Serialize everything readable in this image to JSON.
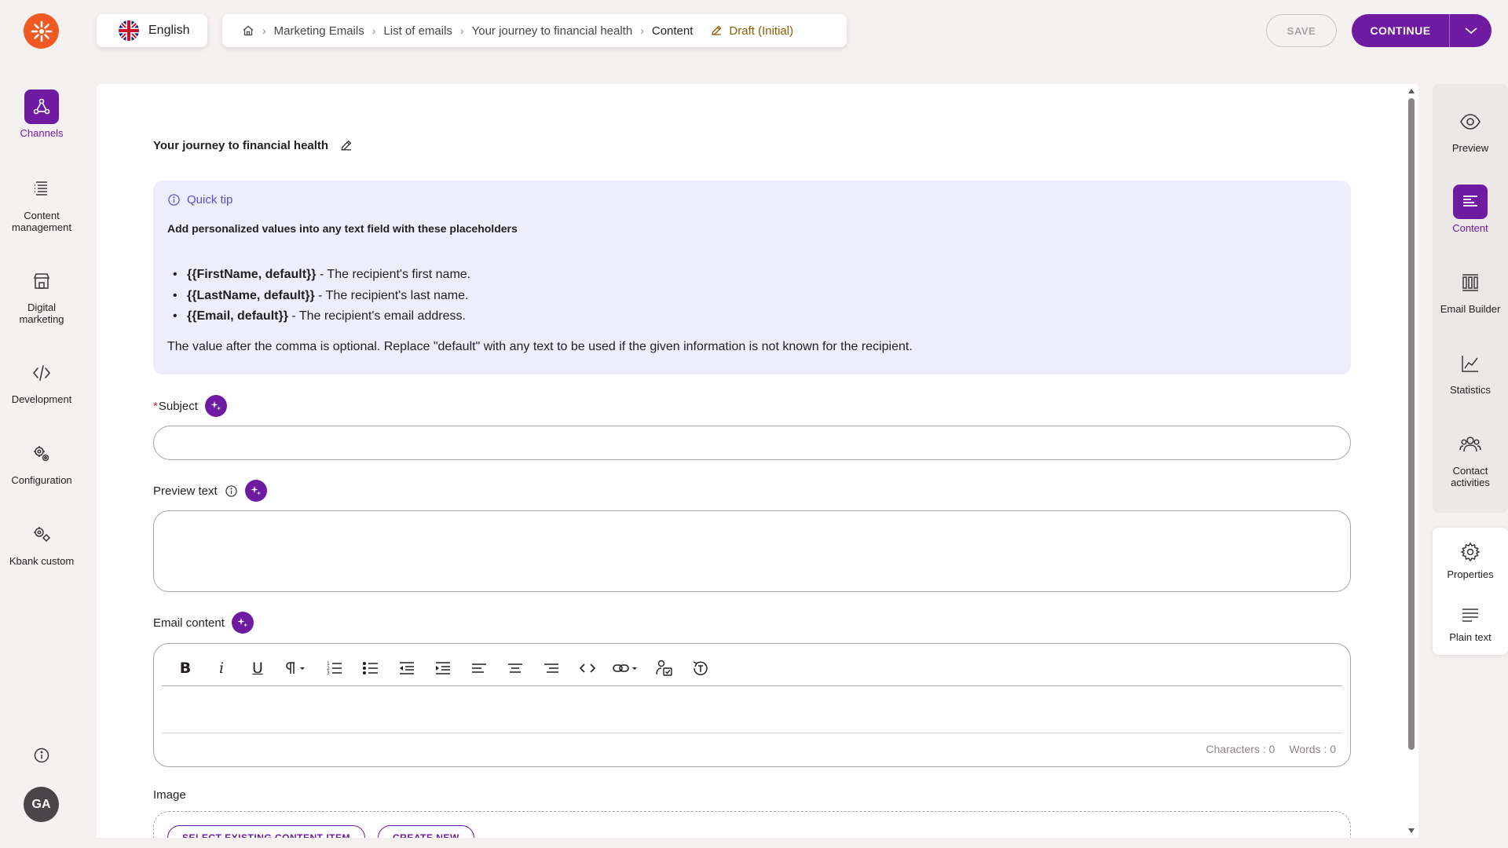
{
  "nav": {
    "items": [
      {
        "label": "Channels",
        "icon": "channels-icon",
        "active": true
      },
      {
        "label": "Content management",
        "icon": "content-management-icon"
      },
      {
        "label": "Digital marketing",
        "icon": "digital-marketing-icon"
      },
      {
        "label": "Development",
        "icon": "code-icon"
      },
      {
        "label": "Configuration",
        "icon": "gears-icon"
      },
      {
        "label": "Kbank custom",
        "icon": "custom-icon"
      }
    ],
    "avatar": "GA"
  },
  "topbar": {
    "language": "English",
    "breadcrumb": [
      "Marketing Emails",
      "List of emails",
      "Your journey to financial health",
      "Content"
    ],
    "status": "Draft (Initial)",
    "save_label": "SAVE",
    "continue_label": "CONTINUE"
  },
  "main": {
    "title": "Your journey to financial health",
    "tip": {
      "heading": "Quick tip",
      "title": "Add personalized values into any text field with these placeholders",
      "items": [
        {
          "code": "{{FirstName, default}}",
          "desc": " - The recipient's first name."
        },
        {
          "code": "{{LastName, default}}",
          "desc": " - The recipient's last name."
        },
        {
          "code": "{{Email, default}}",
          "desc": " - The recipient's email address."
        }
      ],
      "note": "The value after the comma is optional. Replace \"default\" with any text to be used if the given information is not known for the recipient."
    },
    "subject_label": "Subject",
    "subject_required_mark": "*",
    "preview_label": "Preview text",
    "email_content_label": "Email content",
    "characters": "Characters : 0",
    "words": "Words : 0",
    "image_label": "Image",
    "select_existing_label": "SELECT EXISTING CONTENT ITEM",
    "create_new_label": "CREATE NEW"
  },
  "right": {
    "items": [
      {
        "label": "Preview",
        "icon": "eye-icon"
      },
      {
        "label": "Content",
        "icon": "content-icon",
        "active": true
      },
      {
        "label": "Email Builder",
        "icon": "email-builder-icon"
      },
      {
        "label": "Statistics",
        "icon": "chart-icon"
      },
      {
        "label": "Contact activities",
        "icon": "contacts-icon"
      }
    ],
    "items2": [
      {
        "label": "Properties",
        "icon": "gear-icon"
      },
      {
        "label": "Plain text",
        "icon": "lines-icon"
      }
    ]
  },
  "colors": {
    "accent": "#6e1ba1",
    "logo": "#f05a22",
    "tip_bg": "#eeedfc",
    "draft": "#8e5d00"
  }
}
